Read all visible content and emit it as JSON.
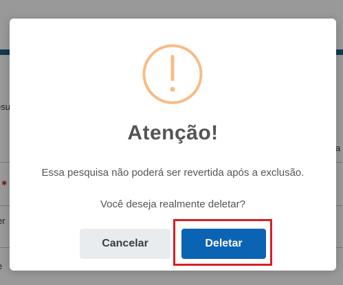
{
  "background": {
    "fragment_left_a": "esu",
    "fragment_left_b": "er",
    "fragment_left_c": "e",
    "fragment_right_a": "a"
  },
  "dialog": {
    "icon": "exclamation-warning-icon",
    "title": "Atenção!",
    "message_line1": "Essa pesquisa não poderá ser revertida após a exclusão.",
    "message_line2": "Você deseja realmente deletar?",
    "cancel_label": "Cancelar",
    "confirm_label": "Deletar"
  },
  "colors": {
    "icon_orange": "#f8bb86",
    "confirm_blue": "#0b63b3",
    "cancel_gray": "#e9ecef",
    "highlight_red": "#d81f26",
    "header_blue": "#1f5f86"
  }
}
